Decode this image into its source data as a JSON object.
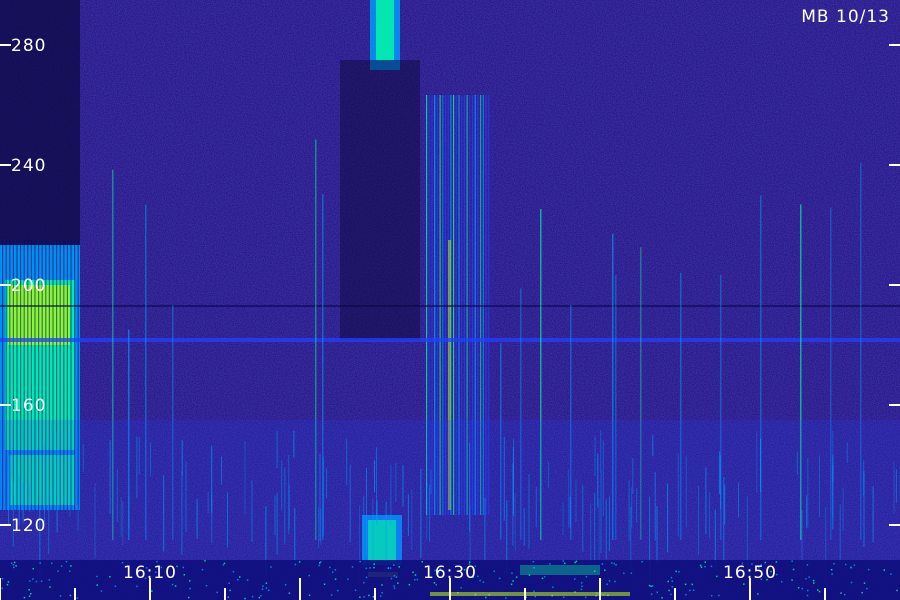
{
  "chart_data": {
    "type": "heatmap",
    "title": "MB 10/13",
    "x_ticks": [
      "16:10",
      "16:30",
      "16:50"
    ],
    "y_ticks": [
      "280",
      "240",
      "200",
      "160",
      "120"
    ],
    "ylim": [
      110,
      295
    ],
    "xlim": [
      "16:00",
      "16:59"
    ],
    "colormap": [
      "#000033",
      "#1010a0",
      "#2040ff",
      "#00a0ff",
      "#00ffa0",
      "#c0ff00",
      "#ffff00"
    ]
  }
}
